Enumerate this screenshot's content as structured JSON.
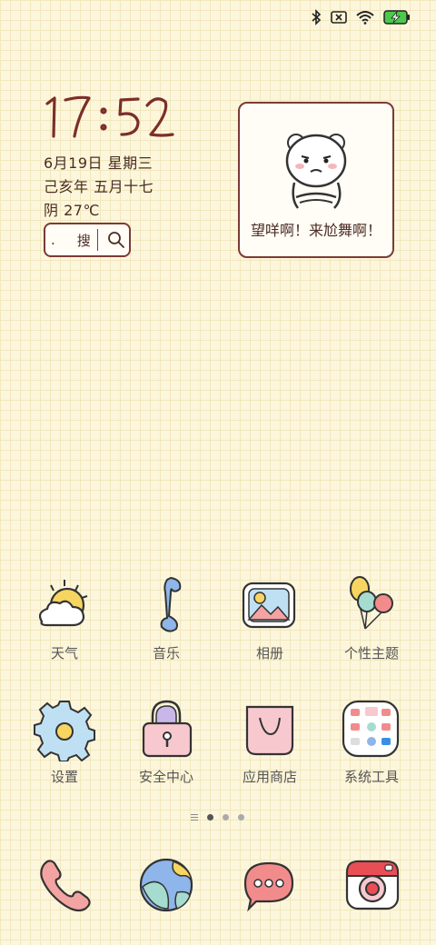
{
  "status_bar": {
    "icons": [
      "bluetooth-icon",
      "no-sim-icon",
      "wifi-icon",
      "battery-charging-icon"
    ]
  },
  "clock": {
    "time": "17:52",
    "date": "6月19日 星期三",
    "lunar": "己亥年 五月十七",
    "weather": "阴  27℃"
  },
  "search_widget": {
    "dot": ".",
    "label": "搜"
  },
  "meme_widget": {
    "caption": "望咩啊！来尬舞啊！"
  },
  "apps_row1": [
    {
      "label": "天气",
      "icon": "weather-icon"
    },
    {
      "label": "音乐",
      "icon": "music-icon"
    },
    {
      "label": "相册",
      "icon": "gallery-icon"
    },
    {
      "label": "个性主题",
      "icon": "theme-balloons-icon"
    }
  ],
  "apps_row2": [
    {
      "label": "设置",
      "icon": "settings-gear-icon"
    },
    {
      "label": "安全中心",
      "icon": "security-lock-icon"
    },
    {
      "label": "应用商店",
      "icon": "app-store-bag-icon"
    },
    {
      "label": "系统工具",
      "icon": "system-tools-icon"
    }
  ],
  "page_indicator": {
    "pages": 3,
    "active": 1
  },
  "dock": [
    {
      "icon": "phone-icon"
    },
    {
      "icon": "browser-globe-icon"
    },
    {
      "icon": "messages-icon"
    },
    {
      "icon": "camera-icon"
    }
  ],
  "colors": {
    "background": "#fcf6dd",
    "grid": "#f2e7bd",
    "outline": "#7b3b35",
    "text": "#4a2c24"
  }
}
